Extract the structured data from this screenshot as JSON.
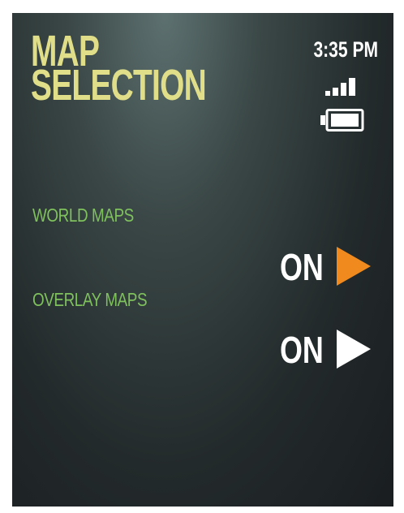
{
  "header": {
    "title_line1": "MAP",
    "title_line2": "SELECTION",
    "time": "3:35 PM"
  },
  "status_icons": [
    "signal-icon",
    "battery-icon"
  ],
  "settings": [
    {
      "label": "WORLD MAPS",
      "value": "ON",
      "arrow_color": "#f08a1e",
      "selected": true
    },
    {
      "label": "OVERLAY MAPS",
      "value": "ON",
      "arrow_color": "#ffffff",
      "selected": false
    }
  ],
  "colors": {
    "title": "#e0de88",
    "label": "#7fc15d",
    "value": "#ffffff",
    "accent": "#f08a1e"
  }
}
